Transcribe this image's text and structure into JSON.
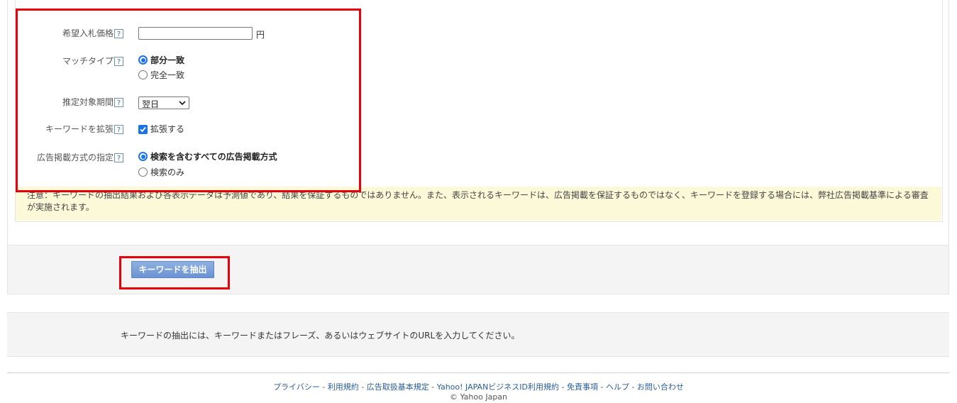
{
  "form": {
    "bid_price": {
      "label": "希望入札価格",
      "value": "",
      "unit": "円"
    },
    "match_type": {
      "label": "マッチタイプ",
      "options": [
        "部分一致",
        "完全一致"
      ],
      "selected": "部分一致"
    },
    "period": {
      "label": "推定対象期間",
      "selected": "翌日"
    },
    "expand": {
      "label": "キーワードを拡張",
      "checkbox_label": "拡張する",
      "checked": true
    },
    "ad_method": {
      "label": "広告掲載方式の指定",
      "options": [
        "検索を含むすべての広告掲載方式",
        "検索のみ"
      ],
      "selected": "検索を含むすべての広告掲載方式"
    },
    "help_glyph": "?"
  },
  "notice": "注意：キーワードの抽出結果および各表示データは予測値であり、結果を保証するものではありません。また、表示されるキーワードは、広告掲載を保証するものではなく、キーワードを登録する場合には、弊社広告掲載基準による審査が実施されます。",
  "actions": {
    "extract_label": "キーワードを抽出"
  },
  "info": {
    "text": "キーワードの抽出には、キーワードまたはフレーズ、あるいはウェブサイトのURLを入力してください。"
  },
  "footer": {
    "links": [
      "プライバシー",
      "利用規約",
      "広告取扱基本規定",
      "Yahoo! JAPANビジネスID利用規約",
      "免責事項",
      "ヘルプ",
      "お問い合わせ"
    ],
    "separator": " - ",
    "copyright": "© Yahoo Japan"
  },
  "colors": {
    "accent": "#1a73e8",
    "highlight_frame": "#e8000b",
    "notice_bg": "#fbf9d8",
    "link": "#2a5d9b"
  }
}
